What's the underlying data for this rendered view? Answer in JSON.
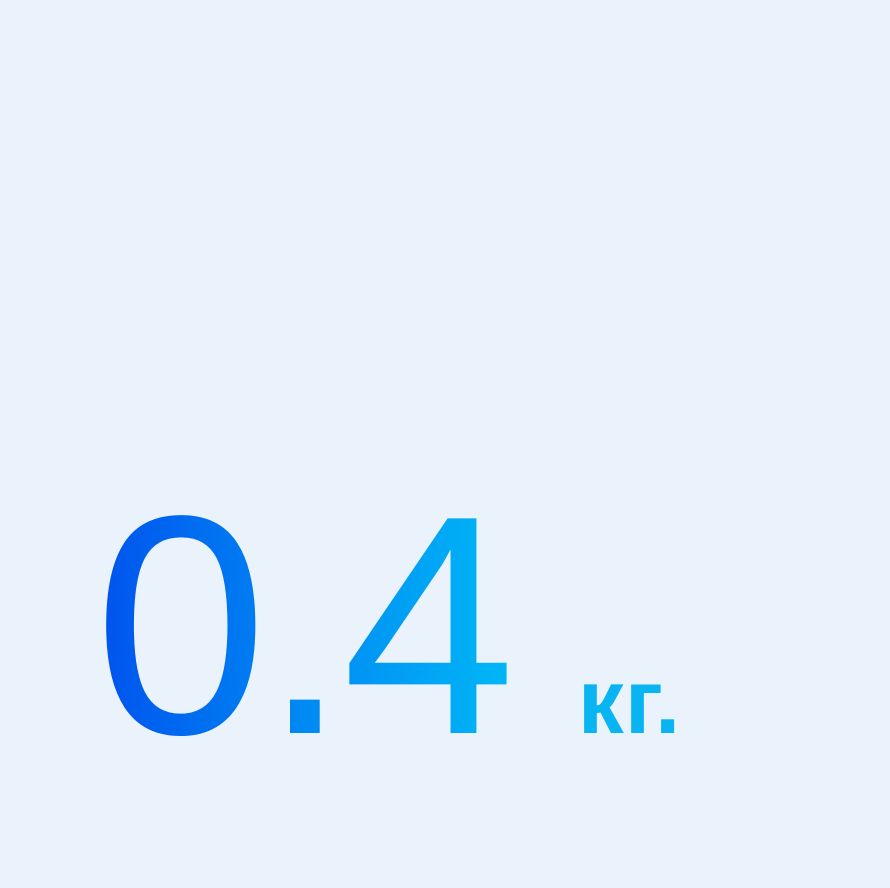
{
  "weight": {
    "value": "0.4",
    "unit": "кг."
  },
  "colors": {
    "background": "#EAF2FC",
    "gradient_start": "#0052EE",
    "gradient_end": "#00B7F6",
    "unit": "#08B4F1"
  }
}
